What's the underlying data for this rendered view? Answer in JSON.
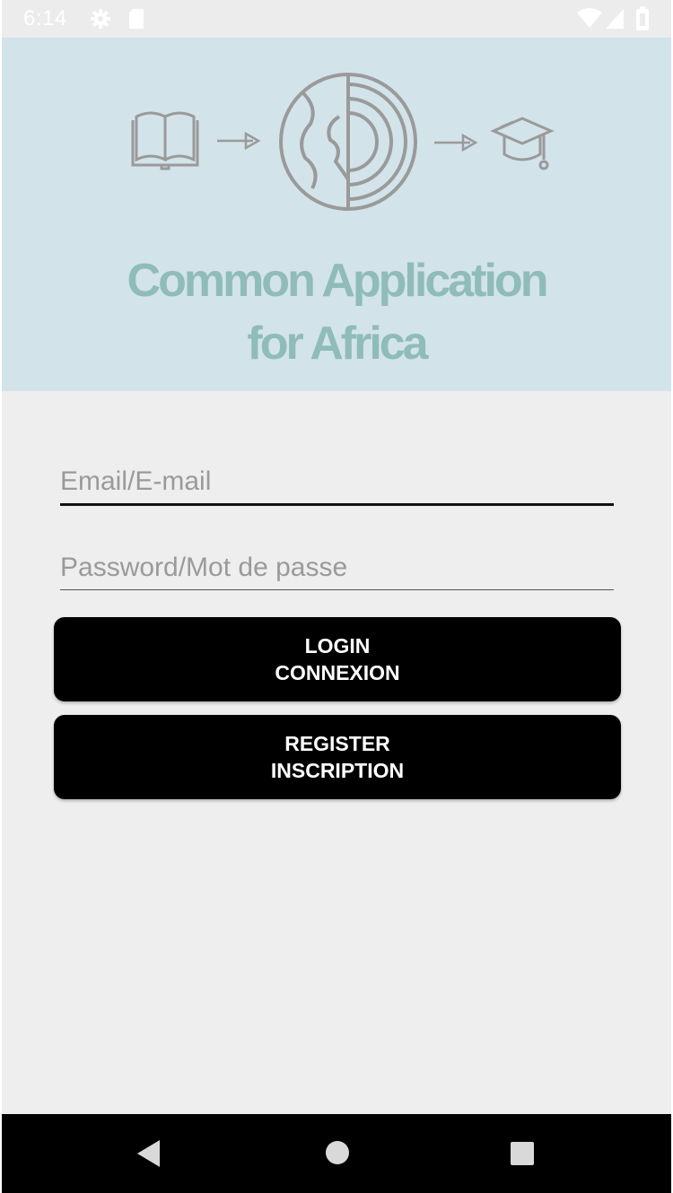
{
  "status_bar": {
    "time": "6:14",
    "icons": [
      "gear-icon",
      "sd-card-icon",
      "wifi-icon",
      "signal-icon",
      "battery-icon"
    ]
  },
  "header": {
    "title_line1": "Common Application",
    "title_line2": "for Africa",
    "title_color": "#8fbcb8",
    "background_color": "#d3e3ea",
    "logo_icons": [
      "book-icon",
      "arrow-right-icon",
      "globe-icon",
      "arrow-right-icon",
      "graduation-cap-icon"
    ]
  },
  "login_form": {
    "email_placeholder": "Email/E-mail",
    "email_value": "",
    "password_placeholder": "Password/Mot de passe",
    "password_value": "",
    "login_label_line1": "LOGIN",
    "login_label_line2": "CONNEXION",
    "register_label_line1": "REGISTER",
    "register_label_line2": "INSCRIPTION"
  },
  "nav_bar": {
    "buttons": [
      "back-icon",
      "home-icon",
      "recents-icon"
    ]
  }
}
